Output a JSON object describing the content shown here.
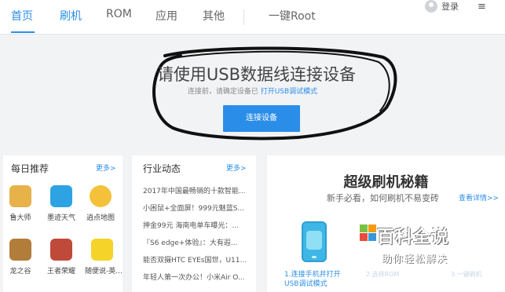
{
  "nav": {
    "tabs": [
      {
        "label": "首页",
        "active": true
      },
      {
        "label": "刷机",
        "active": false
      },
      {
        "label": "ROM",
        "active": false
      },
      {
        "label": "应用",
        "active": false
      },
      {
        "label": "其他",
        "active": false
      }
    ],
    "root_label": "一键Root",
    "login_label": "登录",
    "menu_icon": "≡"
  },
  "hero": {
    "title": "请使用USB数据线连接设备",
    "subtitle_prefix": "连接前，请确定设备已",
    "subtitle_link": "打开USB调试模式",
    "connect_button": "连接设备"
  },
  "daily": {
    "title": "每日推荐",
    "more": "更多>",
    "apps": [
      {
        "name": "鲁大师",
        "icon": "ludashi-icon",
        "color": "#e7b24a"
      },
      {
        "name": "墨迹天气",
        "icon": "weather-icon",
        "color": "#2ea3e3"
      },
      {
        "name": "逍点地图",
        "icon": "lollipop-icon",
        "color": "#f4c23a"
      },
      {
        "name": "龙之谷",
        "icon": "game-dragon-icon",
        "color": "#b27d3a"
      },
      {
        "name": "王者荣耀",
        "icon": "game-hero-icon",
        "color": "#c04a3a"
      },
      {
        "name": "随便说-英...",
        "icon": "shuo-icon",
        "color": "#f5d328"
      }
    ]
  },
  "news": {
    "title": "行业动态",
    "more": "更多>",
    "items": [
      "2017年中国最畅销的十款智能...",
      "小困鼠+全面屏！999元魅蓝S...",
      "抻金99元 海南电单车曝光：...",
      "『S6 edge+体验』：大有遐...",
      "能否双摄HTC EYEs国世，U11...",
      "年轻人第一次办公！小米Air O..."
    ]
  },
  "secret": {
    "title": "超级刷机秘籍",
    "subtitle": "新手必看，如何刷机不易变砖",
    "link": "查看详情>>",
    "step1_line1": "1.连接手机并打开",
    "step1_line2": "USB调试模式",
    "step2": "2.选择ROM",
    "step3": "3.一键刷机"
  },
  "watermark": {
    "main": "百科全说",
    "sub": "助你轻松解决"
  },
  "colors": {
    "accent": "#2a8ee8",
    "hero_bg": "#f2f3f5"
  }
}
